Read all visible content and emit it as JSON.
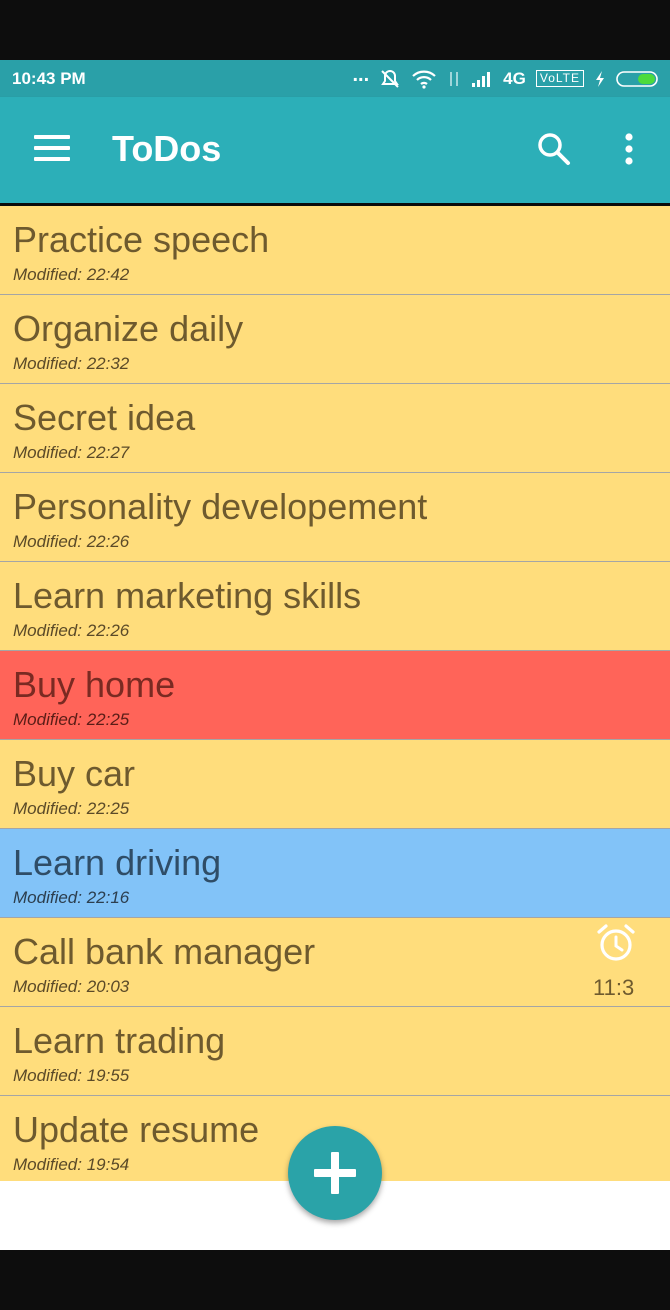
{
  "status_bar": {
    "time": "10:43 PM",
    "dots": "...",
    "network": "4G",
    "volte": "VoLTE",
    "icons": [
      "mute-icon",
      "wifi-icon",
      "data-arrows-icon",
      "signal-icon",
      "charging-icon",
      "battery-icon"
    ]
  },
  "app_bar": {
    "title": "ToDos",
    "icons": [
      "menu-icon",
      "search-icon",
      "more-vert-icon"
    ]
  },
  "todos": [
    {
      "title": "Practice speech",
      "modified": "Modified: 22:42",
      "color": "#ffdd7c"
    },
    {
      "title": "Organize daily",
      "modified": "Modified: 22:32",
      "color": "#ffdd7c"
    },
    {
      "title": "Secret idea",
      "modified": "Modified: 22:27",
      "color": "#ffdd7c"
    },
    {
      "title": "Personality developement",
      "modified": "Modified: 22:26",
      "color": "#ffdd7c"
    },
    {
      "title": "Learn marketing skills",
      "modified": "Modified: 22:26",
      "color": "#ffdd7c"
    },
    {
      "title": "Buy home",
      "modified": "Modified: 22:25",
      "color": "#ff6459"
    },
    {
      "title": "Buy car",
      "modified": "Modified: 22:25",
      "color": "#ffdd7c"
    },
    {
      "title": "Learn driving",
      "modified": "Modified: 22:16",
      "color": "#82c3f8"
    },
    {
      "title": "Call bank manager",
      "modified": "Modified: 20:03",
      "color": "#ffdd7c",
      "alarm": "11:3",
      "alarm_icon": "alarm-clock-icon"
    },
    {
      "title": "Learn trading",
      "modified": "Modified: 19:55",
      "color": "#ffdd7c"
    },
    {
      "title": "Update resume",
      "modified": "Modified: 19:54",
      "color": "#ffdd7c"
    }
  ],
  "fab": {
    "icon": "plus-icon",
    "color": "#2aa3a8"
  },
  "colors": {
    "status_bar": "#2aa0a8",
    "app_bar": "#2cafb8",
    "note_yellow": "#ffdd7c",
    "note_red": "#ff6459",
    "note_blue": "#82c3f8"
  }
}
